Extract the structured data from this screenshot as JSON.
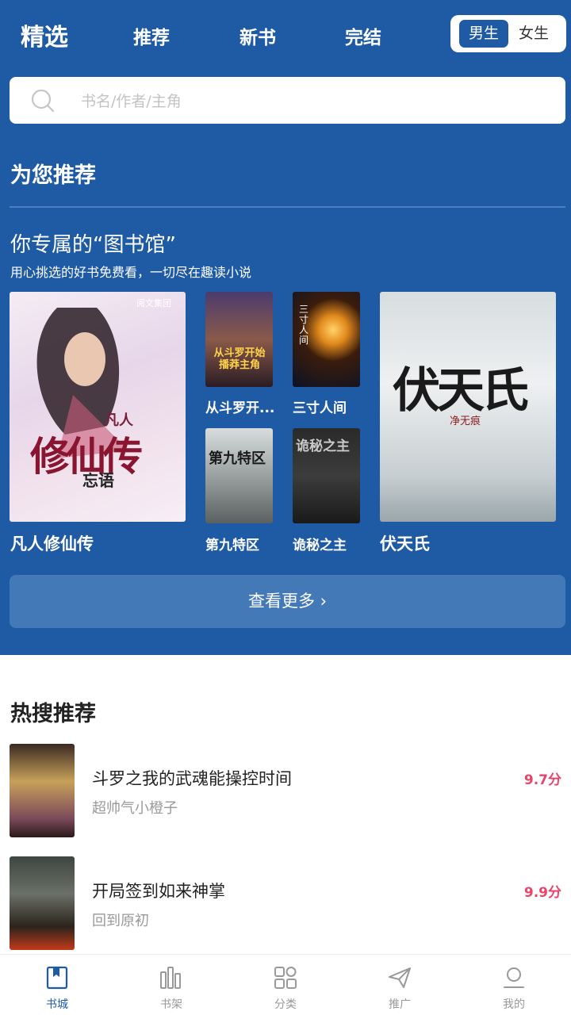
{
  "header": {
    "tabs": [
      "精选",
      "推荐",
      "新书",
      "完结"
    ],
    "gender": {
      "male": "男生",
      "female": "女生"
    }
  },
  "search": {
    "placeholder": "书名/作者/主角"
  },
  "recommend": {
    "title": "为您推荐"
  },
  "library": {
    "title": "你专属的“图书馆”",
    "subtitle": "用心挑选的好书免费看，一切尽在趣读小说",
    "books": [
      {
        "title": "凡人修仙传",
        "cover_text": "修仙传",
        "cover_small": "凡人",
        "cover_author": "忘语",
        "publisher": "阅文集团"
      },
      {
        "title": "从斗罗开...",
        "cover_text": "从斗罗开始 播莽主角"
      },
      {
        "title": "三寸人间",
        "cover_text": "三寸人间"
      },
      {
        "title": "第九特区",
        "cover_text": "第九特区"
      },
      {
        "title": "诡秘之主",
        "cover_text": "诡秘之主"
      },
      {
        "title": "伏天氏",
        "cover_text": "伏天氏",
        "cover_author": "净无痕"
      }
    ],
    "more": "查看更多 ›"
  },
  "hot": {
    "title": "热搜推荐",
    "items": [
      {
        "name": "斗罗之我的武魂能操控时间",
        "author": "超帅气小橙子",
        "score": "9.7分"
      },
      {
        "name": "开局签到如来神掌",
        "author": "回到原初",
        "score": "9.9分"
      }
    ]
  },
  "nav": {
    "items": [
      {
        "label": "书城",
        "icon": "book-icon"
      },
      {
        "label": "书架",
        "icon": "shelf-icon"
      },
      {
        "label": "分类",
        "icon": "category-icon"
      },
      {
        "label": "推广",
        "icon": "paper-plane-icon"
      },
      {
        "label": "我的",
        "icon": "user-icon"
      }
    ]
  },
  "colors": {
    "primary": "#1f5aa5",
    "score": "#e8456b"
  }
}
